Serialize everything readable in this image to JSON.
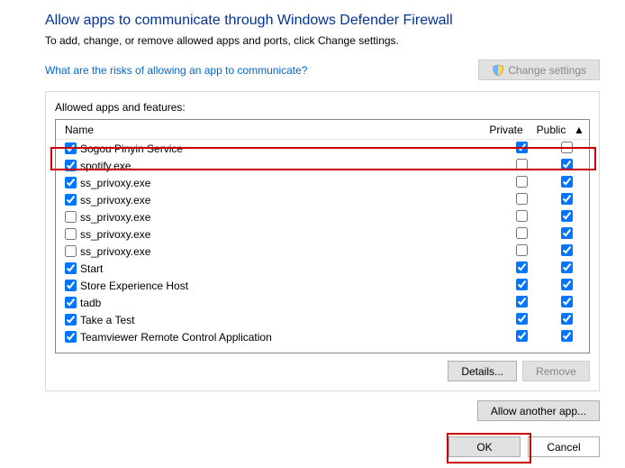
{
  "title": "Allow apps to communicate through Windows Defender Firewall",
  "subtitle": "To add, change, or remove allowed apps and ports, click Change settings.",
  "risk_link": "What are the risks of allowing an app to communicate?",
  "change_settings": "Change settings",
  "panel_label": "Allowed apps and features:",
  "columns": {
    "name": "Name",
    "private": "Private",
    "public": "Public"
  },
  "rows": [
    {
      "name": "Sogou Pinyin Service",
      "enabled": true,
      "private": true,
      "public": false
    },
    {
      "name": "spotify.exe",
      "enabled": true,
      "private": false,
      "public": true
    },
    {
      "name": "ss_privoxy.exe",
      "enabled": true,
      "private": false,
      "public": true
    },
    {
      "name": "ss_privoxy.exe",
      "enabled": true,
      "private": false,
      "public": true
    },
    {
      "name": "ss_privoxy.exe",
      "enabled": false,
      "private": false,
      "public": true
    },
    {
      "name": "ss_privoxy.exe",
      "enabled": false,
      "private": false,
      "public": true
    },
    {
      "name": "ss_privoxy.exe",
      "enabled": false,
      "private": false,
      "public": true
    },
    {
      "name": "Start",
      "enabled": true,
      "private": true,
      "public": true
    },
    {
      "name": "Store Experience Host",
      "enabled": true,
      "private": true,
      "public": true
    },
    {
      "name": "tadb",
      "enabled": true,
      "private": true,
      "public": true
    },
    {
      "name": "Take a Test",
      "enabled": true,
      "private": true,
      "public": true
    },
    {
      "name": "Teamviewer Remote Control Application",
      "enabled": true,
      "private": true,
      "public": true
    }
  ],
  "buttons": {
    "details": "Details...",
    "remove": "Remove",
    "allow_another": "Allow another app...",
    "ok": "OK",
    "cancel": "Cancel"
  }
}
